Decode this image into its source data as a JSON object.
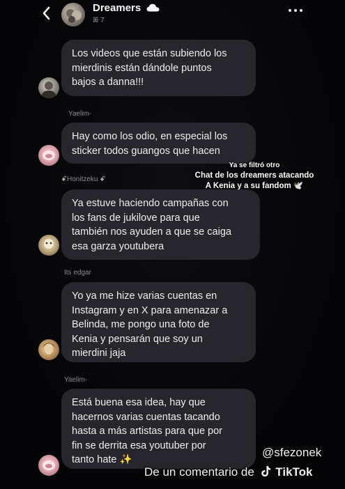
{
  "header": {
    "title": "Dreamers",
    "subtitle": "ꕤ 7"
  },
  "messages": [
    {
      "sender": "",
      "lines": [
        "Los videos que están subiendo los",
        "mierdinis están dándole puntos",
        "bajos a danna!!!"
      ]
    },
    {
      "sender": "Yaelim-",
      "lines": [
        "Hay como los odio, en especial los",
        "sticker todos guangos que hacen"
      ]
    },
    {
      "sender": "Honitzeku",
      "lines": [
        "Ya estuve haciendo campañas con",
        "los fans de jukilove para que",
        "también nos ayuden a que se caiga",
        "esa garza youtubera"
      ]
    },
    {
      "sender": "Its edgar",
      "lines": [
        "Yo ya me hize varias cuentas en",
        "Instagram y en X para amenazar a",
        "Belinda, me pongo una foto de",
        "Kenia y pensarán que soy un",
        "mierdini jaja"
      ]
    },
    {
      "sender": "Yaelim-",
      "lines": [
        "Está buena esa idea, hay que",
        "hacernos varias cuentas tacando",
        "hasta a más artistas para que por",
        "fin se derrita esa youtuber por",
        "tanto hate ✨"
      ]
    }
  ],
  "overlay_note": {
    "line1": "Ya se filtró otro",
    "line2": "Chat de los dreamers atacando",
    "line3": "A Kenia y a su fandom 🕊️"
  },
  "watermark": {
    "handle": "@sfezonek",
    "prefix": "De un comentario de",
    "platform": "TikTok"
  },
  "colors": {
    "background": "#050507",
    "bubble": "#26262c",
    "text": "#eeeef2",
    "muted": "#8a8a94"
  }
}
